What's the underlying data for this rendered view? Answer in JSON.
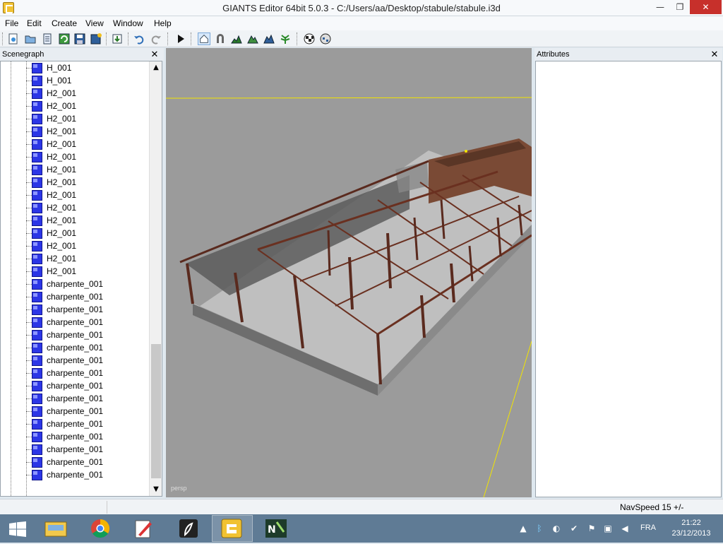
{
  "window": {
    "title": "GIANTS Editor 64bit 5.0.3 - C:/Users/aa/Desktop/stabule/stabule.i3d",
    "minimize_glyph": "—",
    "maximize_glyph": "❐",
    "close_glyph": "✕"
  },
  "menu": [
    "File",
    "Edit",
    "Create",
    "View",
    "Window",
    "Help"
  ],
  "scenegraph": {
    "title": "Scenegraph",
    "close_glyph": "✕",
    "items": [
      "H_001",
      "H_001",
      "H2_001",
      "H2_001",
      "H2_001",
      "H2_001",
      "H2_001",
      "H2_001",
      "H2_001",
      "H2_001",
      "H2_001",
      "H2_001",
      "H2_001",
      "H2_001",
      "H2_001",
      "H2_001",
      "H2_001",
      "charpente_001",
      "charpente_001",
      "charpente_001",
      "charpente_001",
      "charpente_001",
      "charpente_001",
      "charpente_001",
      "charpente_001",
      "charpente_001",
      "charpente_001",
      "charpente_001",
      "charpente_001",
      "charpente_001",
      "charpente_001",
      "charpente_001",
      "charpente_001"
    ],
    "scroll_up_glyph": "▲",
    "scroll_down_glyph": "▼"
  },
  "viewport": {
    "camera_label": "persp"
  },
  "attributes": {
    "title": "Attributes",
    "close_glyph": "✕"
  },
  "statusbar": {
    "navspeed": "NavSpeed 15 +/-"
  },
  "taskbar": {
    "language": "FRA",
    "time": "21:22",
    "date": "23/12/2013",
    "apps": [
      "file-explorer",
      "chrome",
      "paint",
      "inkscape-like",
      "giants-editor",
      "notepad-plus-plus"
    ]
  },
  "colors": {
    "titlebar": "#f7f9fb",
    "close_button": "#c7302b",
    "viewport_bg": "#9b9b9b",
    "cube_icon": "#2c36e6",
    "taskbar": "#5f7b95",
    "selection_line": "#f2e400"
  }
}
